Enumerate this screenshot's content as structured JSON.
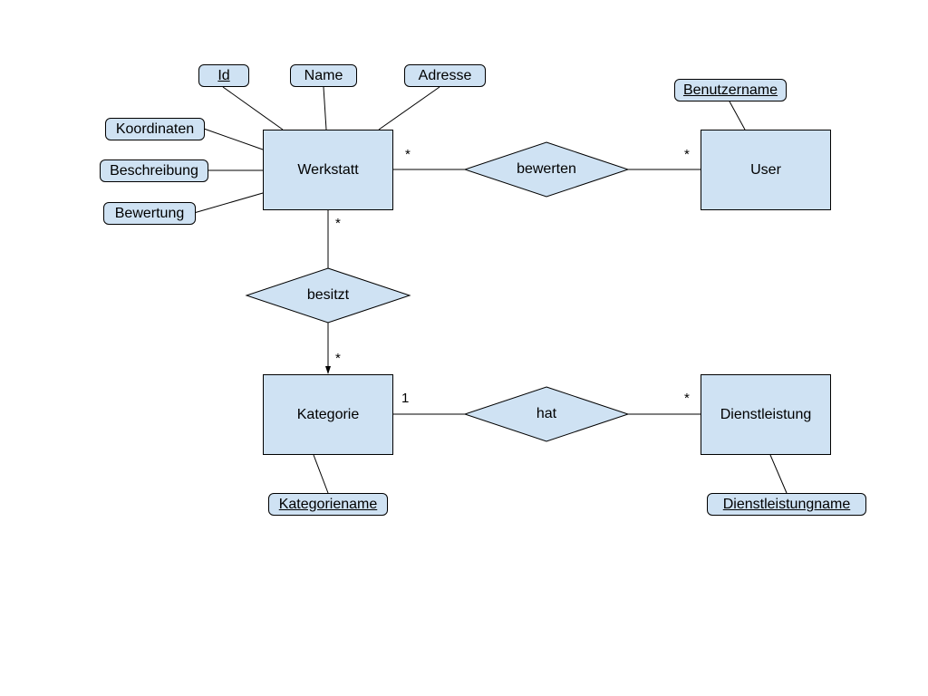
{
  "entities": {
    "werkstatt": "Werkstatt",
    "user": "User",
    "kategorie": "Kategorie",
    "dienstleistung": "Dienstleistung"
  },
  "relationships": {
    "bewerten": "bewerten",
    "besitzt": "besitzt",
    "hat": "hat"
  },
  "attributes": {
    "id": "Id",
    "name": "Name",
    "adresse": "Adresse",
    "koordinaten": "Koordinaten",
    "beschreibung": "Beschreibung",
    "bewertung": "Bewertung",
    "benutzername": "Benutzername",
    "kategoriename": "Kategoriename",
    "dienstleistungname": "Dienstleistungname"
  },
  "cardinalities": {
    "werkstatt_bewerten": "*",
    "user_bewerten": "*",
    "werkstatt_besitzt": "*",
    "kategorie_besitzt": "*",
    "kategorie_hat": "1",
    "dienstleistung_hat": "*"
  }
}
